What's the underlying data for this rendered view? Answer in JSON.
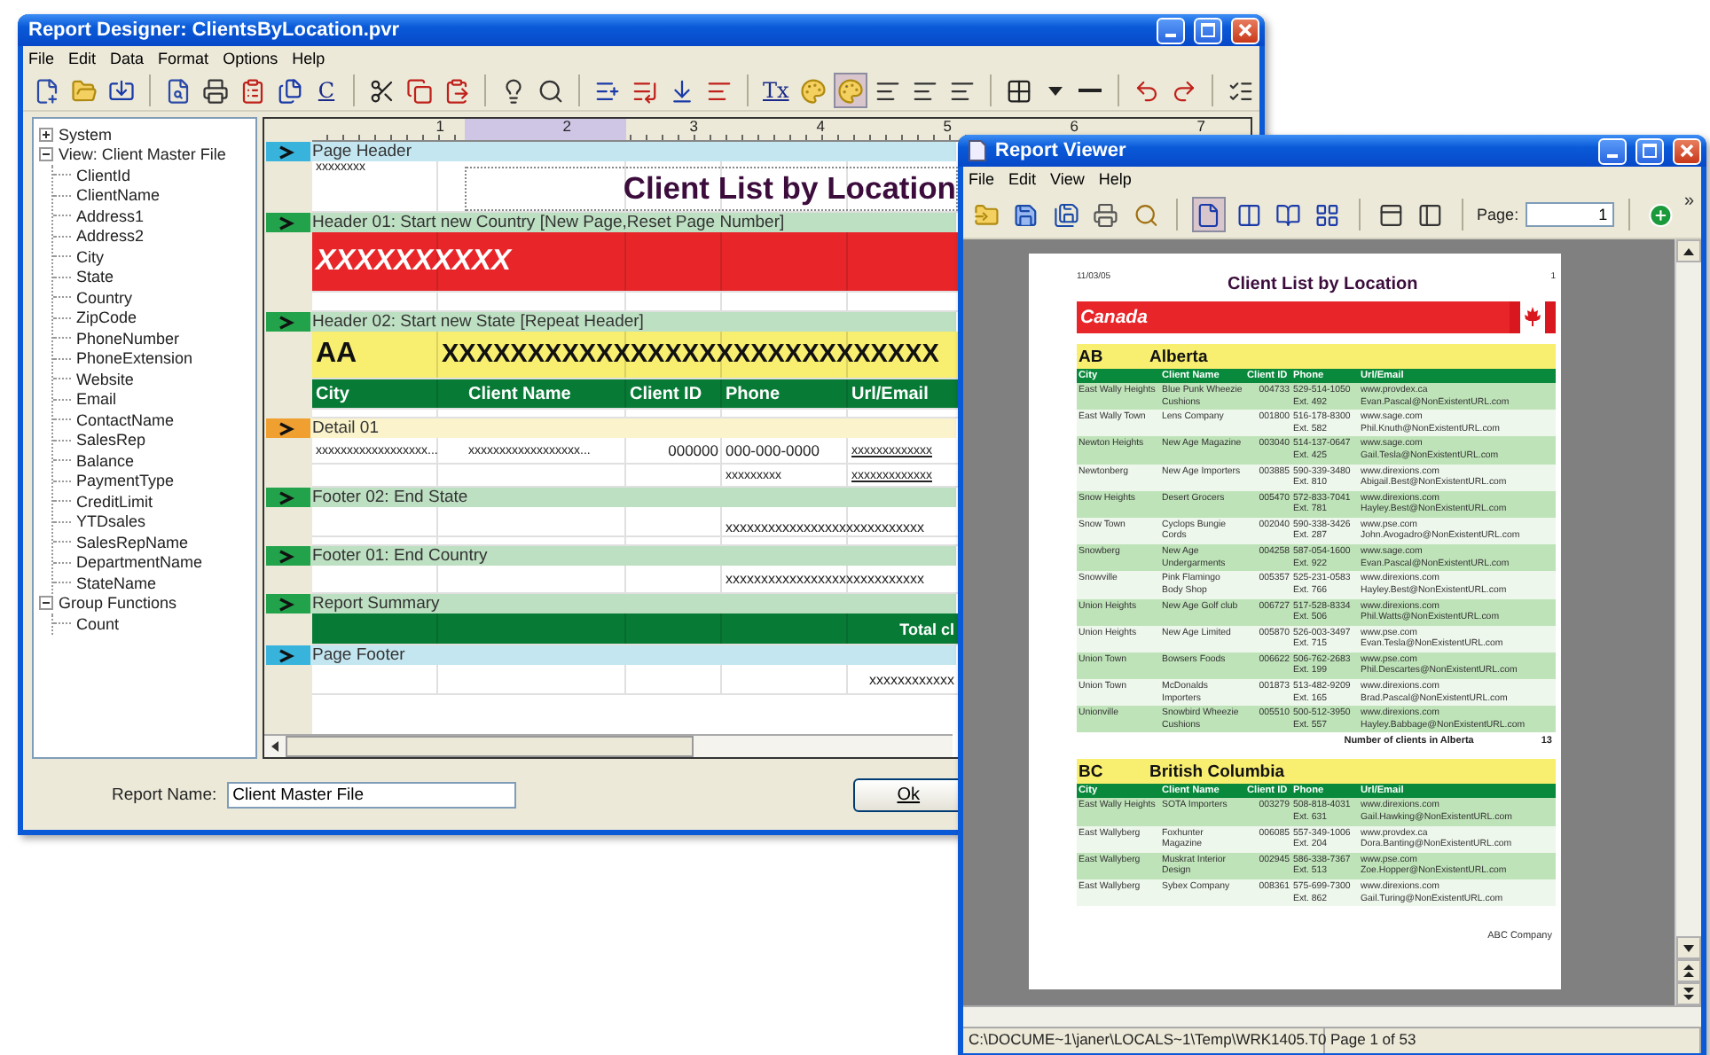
{
  "designer": {
    "title": "Report Designer: ClientsByLocation.pvr",
    "menu": [
      "File",
      "Edit",
      "Data",
      "Format",
      "Options",
      "Help"
    ],
    "toolbar": [
      {
        "kind": "icon",
        "selected": false
      },
      {
        "kind": "icon",
        "selected": false
      },
      {
        "kind": "icon",
        "selected": false
      },
      {
        "kind": "separator"
      },
      {
        "kind": "icon",
        "selected": false
      },
      {
        "kind": "icon",
        "selected": false
      },
      {
        "kind": "icon",
        "selected": false
      },
      {
        "kind": "icon",
        "selected": false
      },
      {
        "kind": "text",
        "label": "C",
        "selected": false
      },
      {
        "kind": "separator"
      },
      {
        "kind": "icon",
        "selected": false
      },
      {
        "kind": "icon",
        "selected": false
      },
      {
        "kind": "icon",
        "selected": false
      },
      {
        "kind": "separator"
      },
      {
        "kind": "icon",
        "selected": false
      },
      {
        "kind": "icon",
        "selected": false
      },
      {
        "kind": "separator"
      },
      {
        "kind": "icon",
        "selected": false
      },
      {
        "kind": "icon",
        "selected": false
      },
      {
        "kind": "icon",
        "selected": false
      },
      {
        "kind": "icon",
        "selected": false
      },
      {
        "kind": "separator"
      },
      {
        "kind": "text",
        "label": "Tx",
        "selected": false
      },
      {
        "kind": "icon",
        "selected": false
      },
      {
        "kind": "icon",
        "selected": true
      },
      {
        "kind": "icon",
        "selected": false
      },
      {
        "kind": "icon",
        "selected": false
      },
      {
        "kind": "icon",
        "selected": false
      },
      {
        "kind": "separator"
      },
      {
        "kind": "icon",
        "selected": false
      },
      {
        "kind": "icon",
        "selected": false
      },
      {
        "kind": "icon",
        "selected": false
      },
      {
        "kind": "separator"
      },
      {
        "kind": "icon",
        "selected": false
      },
      {
        "kind": "icon",
        "selected": false
      },
      {
        "kind": "separator"
      },
      {
        "kind": "icon",
        "selected": false
      }
    ],
    "tree": [
      {
        "label": "System",
        "expanded": false
      },
      {
        "label": "View: Client Master File",
        "expanded": true,
        "children": [
          {
            "label": "ClientId"
          },
          {
            "label": "ClientName"
          },
          {
            "label": "Address1"
          },
          {
            "label": "Address2"
          },
          {
            "label": "City"
          },
          {
            "label": "State"
          },
          {
            "label": "Country"
          },
          {
            "label": "ZipCode"
          },
          {
            "label": "PhoneNumber"
          },
          {
            "label": "PhoneExtension"
          },
          {
            "label": "Website"
          },
          {
            "label": "Email"
          },
          {
            "label": "ContactName"
          },
          {
            "label": "SalesRep"
          },
          {
            "label": "Balance"
          },
          {
            "label": "PaymentType"
          },
          {
            "label": "CreditLimit"
          },
          {
            "label": "YTDsales"
          },
          {
            "label": "SalesRepName"
          },
          {
            "label": "DepartmentName"
          },
          {
            "label": "StateName"
          }
        ]
      },
      {
        "label": "Group Functions",
        "expanded": true,
        "children": [
          {
            "label": "Count"
          }
        ]
      }
    ],
    "ruler": [
      "1",
      "2",
      "3",
      "4",
      "5",
      "6",
      "7"
    ],
    "sections": [
      {
        "kind": "page",
        "label": "Page Header",
        "rows": [
          {
            "kind": "title",
            "cells": [
              "xxxxxxxx",
              "Client List by Location"
            ]
          }
        ]
      },
      {
        "kind": "group",
        "label": "Header 01: Start new Country [New Page,Reset Page Number]",
        "rows": [
          {
            "kind": "red",
            "cells": [
              "XXXXXXXXXX"
            ]
          },
          {
            "kind": "spacer"
          }
        ]
      },
      {
        "kind": "group",
        "label": "Header 02: Start new State [Repeat Header]",
        "rows": [
          {
            "kind": "state",
            "cells": [
              "AA",
              "XXXXXXXXXXXXXXXXXXXXXXXXXXXXX"
            ]
          },
          {
            "kind": "header",
            "cells": [
              "City",
              "Client Name",
              "Client ID",
              "Phone",
              "Url/Email"
            ]
          },
          {
            "kind": "gap"
          }
        ]
      },
      {
        "kind": "detail",
        "label": "Detail 01",
        "rows": [
          {
            "kind": "detail",
            "cells": [
              "xxxxxxxxxxxxxxxxxx...",
              "xxxxxxxxxxxxxxxxxx...",
              "000000",
              "000-000-0000",
              "xxxxxxxxxxxxx"
            ]
          },
          {
            "kind": "detail2",
            "cells": [
              "",
              "",
              "",
              "xxxxxxxxx",
              "xxxxxxxxxxxxx"
            ]
          }
        ]
      },
      {
        "kind": "group",
        "label": "Footer 02: End State",
        "rows": [
          {
            "kind": "total",
            "cells": [
              "xxxxxxxxxxxxxxxxxxxxxxxxxxxx"
            ]
          },
          {
            "kind": "gap"
          }
        ]
      },
      {
        "kind": "group",
        "label": "Footer 01: End Country",
        "rows": [
          {
            "kind": "yellow_total",
            "cells": [
              "xxxxxxxxxxxxxxxxxxxxxxxxxxxx"
            ]
          }
        ]
      },
      {
        "kind": "group",
        "label": "Report Summary",
        "rows": [
          {
            "kind": "summary",
            "cells": [
              "Total cl"
            ]
          }
        ]
      },
      {
        "kind": "page",
        "label": "Page Footer",
        "rows": [
          {
            "kind": "page_footer",
            "cells": [
              "xxxxxxxxxxxx"
            ]
          }
        ]
      }
    ],
    "report_name": {
      "label": "Report Name:",
      "value": "Client Master File"
    },
    "ok_button": "Ok"
  },
  "viewer": {
    "title": "Report Viewer",
    "menu": [
      "File",
      "Edit",
      "View",
      "Help"
    ],
    "toolbar": [
      {
        "kind": "icon",
        "selected": false
      },
      {
        "kind": "icon",
        "selected": false
      },
      {
        "kind": "icon",
        "selected": false
      },
      {
        "kind": "icon",
        "selected": false
      },
      {
        "kind": "icon",
        "selected": false
      },
      {
        "kind": "separator"
      },
      {
        "kind": "icon",
        "selected": true
      },
      {
        "kind": "icon",
        "selected": false
      },
      {
        "kind": "icon",
        "selected": false
      },
      {
        "kind": "icon",
        "selected": false
      },
      {
        "kind": "separator"
      },
      {
        "kind": "icon",
        "selected": false
      },
      {
        "kind": "icon",
        "selected": false
      },
      {
        "kind": "separator"
      },
      {
        "kind": "page_field",
        "label": "Page:",
        "value": "1"
      },
      {
        "kind": "separator"
      },
      {
        "kind": "icon",
        "selected": false
      },
      {
        "kind": "overflow",
        "label": "»"
      }
    ],
    "report": {
      "date": "11/03/05",
      "title": "Client List by Location",
      "page_number": "1",
      "country": "Canada",
      "groups": [
        {
          "code": "AB",
          "name": "Alberta",
          "columns": [
            "City",
            "Client Name",
            "Client ID",
            "Phone",
            "Url/Email"
          ],
          "rows": [
            {
              "city": "East Wally Heights",
              "name": "Blue Punk Wheezie Cushions",
              "id": "004733",
              "phone": "529-514-1050",
              "ext": "Ext. 492",
              "url": "www.provdex.ca",
              "email": "Evan.Pascal@NonExistentURL.com"
            },
            {
              "city": "East Wally Town",
              "name": "Lens Company",
              "id": "001800",
              "phone": "516-178-8300",
              "ext": "Ext. 582",
              "url": "www.sage.com",
              "email": "Phil.Knuth@NonExistentURL.com"
            },
            {
              "city": "Newton Heights",
              "name": "New Age Magazine",
              "id": "003040",
              "phone": "514-137-0647",
              "ext": "Ext. 425",
              "url": "www.sage.com",
              "email": "Gail.Tesla@NonExistentURL.com"
            },
            {
              "city": "Newtonberg",
              "name": "New Age Importers",
              "id": "003885",
              "phone": "590-339-3480",
              "ext": "Ext. 810",
              "url": "www.direxions.com",
              "email": "Abigail.Best@NonExistentURL.com"
            },
            {
              "city": "Snow Heights",
              "name": "Desert Grocers",
              "id": "005470",
              "phone": "572-833-7041",
              "ext": "Ext. 781",
              "url": "www.direxions.com",
              "email": "Hayley.Best@NonExistentURL.com"
            },
            {
              "city": "Snow Town",
              "name": "Cyclops Bungie Cords",
              "id": "002040",
              "phone": "590-338-3426",
              "ext": "Ext. 287",
              "url": "www.pse.com",
              "email": "John.Avogadro@NonExistentURL.com"
            },
            {
              "city": "Snowberg",
              "name": "New Age Undergarments",
              "id": "004258",
              "phone": "587-054-1600",
              "ext": "Ext. 922",
              "url": "www.sage.com",
              "email": "Evan.Pascal@NonExistentURL.com"
            },
            {
              "city": "Snowville",
              "name": "Pink Flamingo Body Shop",
              "id": "005357",
              "phone": "525-231-0583",
              "ext": "Ext. 766",
              "url": "www.direxions.com",
              "email": "Hayley.Best@NonExistentURL.com"
            },
            {
              "city": "Union Heights",
              "name": "New Age Golf club",
              "id": "006727",
              "phone": "517-528-8334",
              "ext": "Ext. 506",
              "url": "www.direxions.com",
              "email": "Phil.Watts@NonExistentURL.com"
            },
            {
              "city": "Union Heights",
              "name": "New Age Limited",
              "id": "005870",
              "phone": "526-003-3497",
              "ext": "Ext. 715",
              "url": "www.pse.com",
              "email": "Evan.Tesla@NonExistentURL.com"
            },
            {
              "city": "Union Town",
              "name": "Bowsers Foods",
              "id": "006622",
              "phone": "506-762-2683",
              "ext": "Ext. 199",
              "url": "www.pse.com",
              "email": "Phil.Descartes@NonExistentURL.com"
            },
            {
              "city": "Union Town",
              "name": "McDonalds Importers",
              "id": "001873",
              "phone": "513-482-9209",
              "ext": "Ext. 165",
              "url": "www.direxions.com",
              "email": "Brad.Pascal@NonExistentURL.com"
            },
            {
              "city": "Unionville",
              "name": "Snowbird Wheezie Cushions",
              "id": "005510",
              "phone": "500-512-3950",
              "ext": "Ext. 557",
              "url": "www.direxions.com",
              "email": "Hayley.Babbage@NonExistentURL.com"
            }
          ],
          "count_label": "Number of clients in Alberta",
          "count": "13"
        },
        {
          "code": "BC",
          "name": "British Columbia",
          "columns": [
            "City",
            "Client Name",
            "Client ID",
            "Phone",
            "Url/Email"
          ],
          "rows": [
            {
              "city": "East Wally Heights",
              "name": "SOTA Importers",
              "id": "003279",
              "phone": "508-818-4031",
              "ext": "Ext. 631",
              "url": "www.direxions.com",
              "email": "Gail.Hawking@NonExistentURL.com"
            },
            {
              "city": "East Wallyberg",
              "name": "Foxhunter Magazine",
              "id": "006085",
              "phone": "557-349-1006",
              "ext": "Ext. 204",
              "url": "www.provdex.ca",
              "email": "Dora.Banting@NonExistentURL.com"
            },
            {
              "city": "East Wallyberg",
              "name": "Muskrat Interior Design",
              "id": "002945",
              "phone": "586-338-7367",
              "ext": "Ext. 513",
              "url": "www.pse.com",
              "email": "Zoe.Hopper@NonExistentURL.com"
            },
            {
              "city": "East Wallyberg",
              "name": "Sybex Company",
              "id": "008361",
              "phone": "575-699-7300",
              "ext": "Ext. 862",
              "url": "www.direxions.com",
              "email": "Gail.Turing@NonExistentURL.com"
            }
          ]
        }
      ],
      "footer": "ABC Company"
    },
    "status_bar": [
      "C:\\DOCUME~1\\janer\\LOCALS~1\\Temp\\WRK1405.T0",
      "Page 1 of 53"
    ]
  }
}
